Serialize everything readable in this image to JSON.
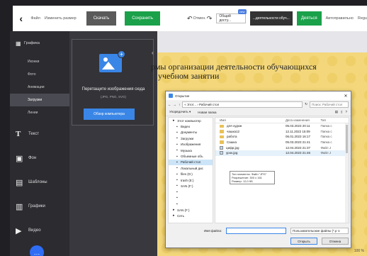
{
  "toolbar": {
    "file": "Файл",
    "resize": "Изменить размер",
    "download": "Скачать",
    "save": "Сохранить",
    "undo_label": "Отмен.",
    "access": "Общий досту...",
    "access_badge": "new",
    "title_field": "...деятельности обуч...",
    "action": "Деяться",
    "author": "Автоправильно",
    "extra": "Regu"
  },
  "sidebar": {
    "sections": [
      {
        "icon": "grid-icon",
        "glyph": "▦",
        "label": "Графика"
      }
    ],
    "sub_items": [
      {
        "label": "Иконки",
        "active": false
      },
      {
        "label": "Фото",
        "active": false
      },
      {
        "label": "Анимации",
        "active": false
      },
      {
        "label": "Загрузки",
        "active": true
      },
      {
        "label": "Линии",
        "active": false
      }
    ],
    "tools": [
      {
        "icon": "text-icon",
        "glyph": "T",
        "label": "Текст"
      },
      {
        "icon": "background-icon",
        "glyph": "▣",
        "label": "Фон"
      },
      {
        "icon": "templates-icon",
        "glyph": "▤",
        "label": "Шаблоны"
      },
      {
        "icon": "charts-icon",
        "glyph": "▥",
        "label": "Графики"
      },
      {
        "icon": "video-icon",
        "glyph": "▶",
        "label": "Видео"
      }
    ]
  },
  "upload": {
    "title": "Перетащите изображения сюда",
    "formats": "(JPG, PNG, SVG)",
    "browse": "Обзор компьютера"
  },
  "canvas": {
    "line1": "рмы организации деятельности обучающихся",
    "line2": "учебном занятии"
  },
  "dialog": {
    "title": "Открытие",
    "path": "« Этот... › Рабочий стол",
    "search_placeholder": "Поиск: Рабочий стол",
    "organize": "Упорядочить ▾",
    "new_folder": "Новая папка",
    "tree": [
      {
        "label": "Этот компьютер",
        "level": 1,
        "selected": false
      },
      {
        "label": "Видео",
        "level": 2,
        "selected": false
      },
      {
        "label": "Документы",
        "level": 2,
        "selected": false
      },
      {
        "label": "Загрузки",
        "level": 2,
        "selected": false
      },
      {
        "label": "Изображения",
        "level": 2,
        "selected": false
      },
      {
        "label": "Музыка",
        "level": 2,
        "selected": false
      },
      {
        "label": "Объемные объ",
        "level": 2,
        "selected": false
      },
      {
        "label": "Рабочий стол",
        "level": 2,
        "selected": true
      },
      {
        "label": "Локальный дис",
        "level": 2,
        "selected": false
      },
      {
        "label": "files (D:)",
        "level": 2,
        "selected": false
      },
      {
        "label": "trash (E:)",
        "level": 2,
        "selected": false
      },
      {
        "label": "SAN (F:)",
        "level": 2,
        "selected": false
      },
      {
        "label": "",
        "level": 2,
        "selected": false
      },
      {
        "label": "",
        "level": 2,
        "selected": false
      },
      {
        "label": "",
        "level": 2,
        "selected": false
      },
      {
        "label": "SAN (F:)",
        "level": 1,
        "selected": false
      },
      {
        "label": "Сеть",
        "level": 1,
        "selected": false
      }
    ],
    "columns": {
      "name": "Имя",
      "date": "Дата изменения",
      "type": "Тип"
    },
    "files": [
      {
        "name": "для худож",
        "date": "05.03.2023 20:11",
        "type": "Папка с",
        "kind": "folder"
      },
      {
        "name": "чашка12",
        "date": "12.11.2022 15:09",
        "type": "Папка с",
        "kind": "folder"
      },
      {
        "name": "работа",
        "date": "06.01.2023 16:17",
        "type": "Папка с",
        "kind": "folder"
      },
      {
        "name": "Сашка",
        "date": "05.03.2023 21:41",
        "type": "Папка с",
        "kind": "folder"
      },
      {
        "name": "цифр.jpg",
        "date": "12.04.2023 21:37",
        "type": "Файл J",
        "kind": "image"
      },
      {
        "name": "урок.jpg",
        "date": "12.04.2023 21:46",
        "type": "Файл J",
        "kind": "image"
      }
    ],
    "tooltip": {
      "line1": "Тип элемента: Файл \"JPG\"",
      "line2": "Разрешение: 300 x 161",
      "line3": "Размер: 12,0 КБ"
    },
    "filename_label": "Имя файла:",
    "filetype": "Пользовательские файлы (*.p ∨",
    "open": "Открыть",
    "cancel": "Отмена"
  },
  "zoom": "100 %"
}
